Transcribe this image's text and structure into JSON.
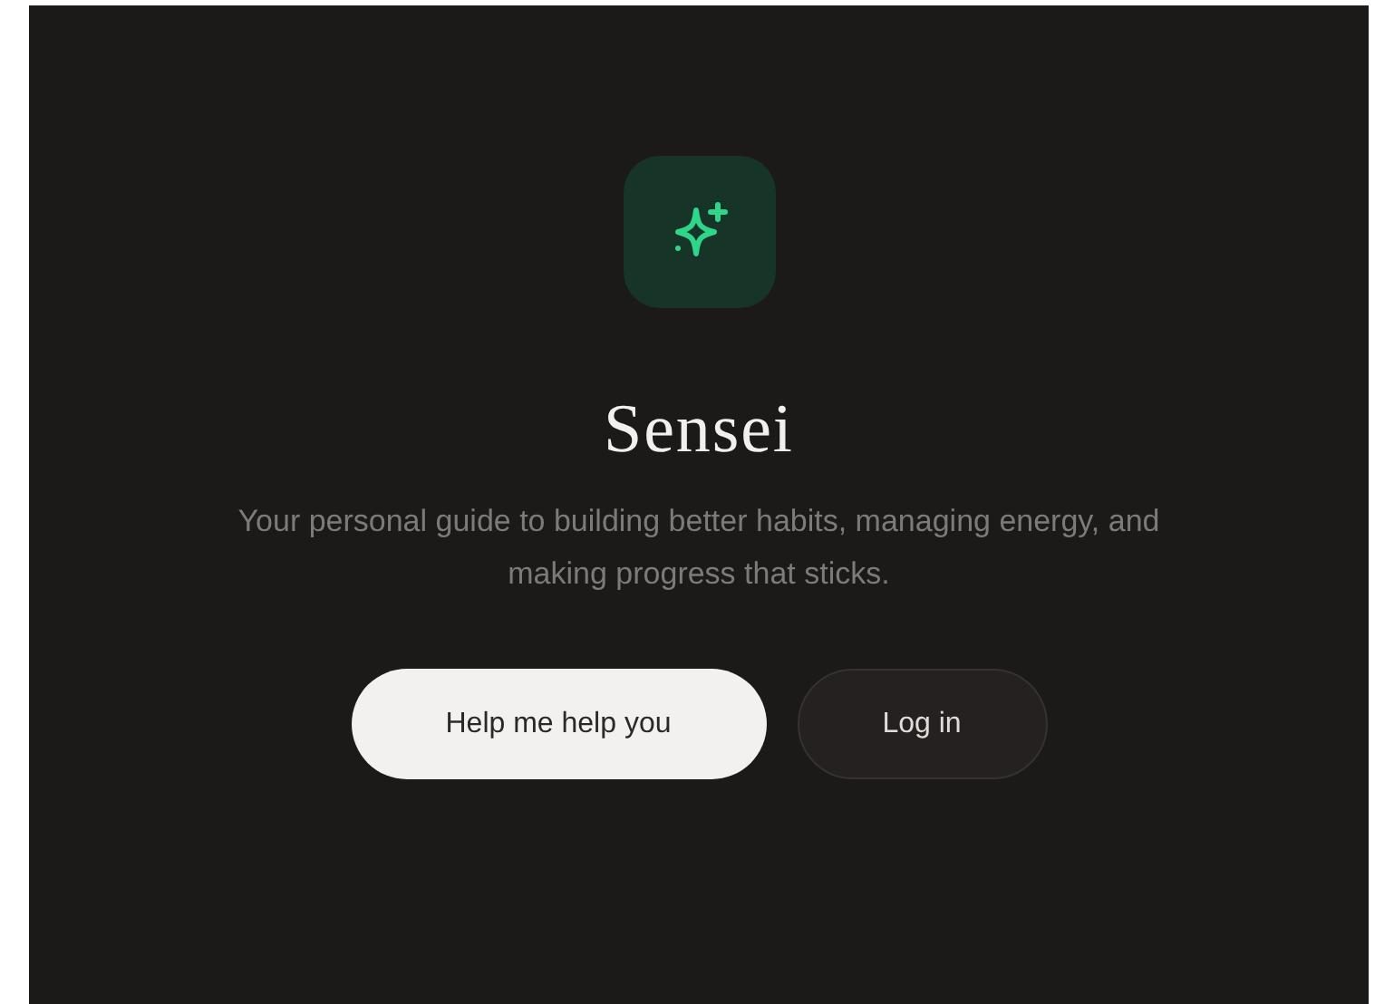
{
  "app": {
    "title": "Sensei",
    "tagline": "Your personal guide to building better habits, managing energy, and making progress that sticks."
  },
  "buttons": [
    {
      "label": "Help me help you",
      "kind": "primary"
    },
    {
      "label": "Log in",
      "kind": "secondary"
    }
  ]
}
